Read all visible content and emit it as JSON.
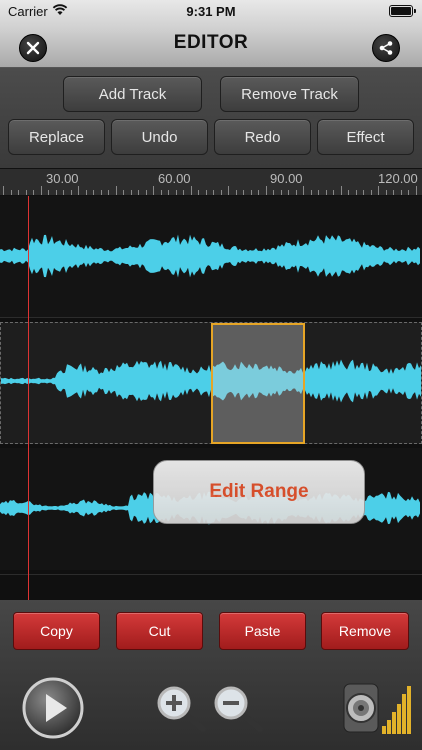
{
  "status_bar": {
    "carrier": "Carrier",
    "time": "9:31 PM"
  },
  "header": {
    "title": "EDITOR"
  },
  "toolbar": {
    "add_track": "Add Track",
    "remove_track": "Remove Track",
    "replace": "Replace",
    "undo": "Undo",
    "redo": "Redo",
    "effect": "Effect"
  },
  "ruler": {
    "ticks": [
      "30.00",
      "60.00",
      "90.00",
      "120.00"
    ]
  },
  "tracks": {
    "tooltip": "Edit Range"
  },
  "edit_actions": {
    "copy": "Copy",
    "cut": "Cut",
    "paste": "Paste",
    "remove": "Remove"
  },
  "colors": {
    "waveform": "#4ccfe8",
    "selection_border": "#e6a526",
    "action_button": "#c02a2a",
    "tooltip_text": "#e5532d",
    "playhead": "#dd3333"
  },
  "icons": [
    "close-icon",
    "share-icon",
    "play-icon",
    "zoom-in-icon",
    "zoom-out-icon",
    "speaker-volume-icon"
  ]
}
